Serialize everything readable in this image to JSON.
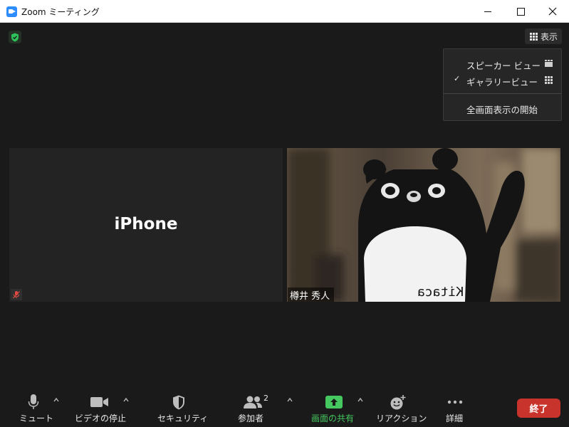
{
  "window": {
    "title": "Zoom ミーティング"
  },
  "top_bar": {
    "view_button_label": "表示"
  },
  "view_menu": {
    "speaker_view": "スピーカー ビュー",
    "gallery_view": "ギャラリービュー",
    "gallery_checked": true,
    "fullscreen": "全画面表示の開始"
  },
  "participants": [
    {
      "name": "iPhone",
      "audio_muted": true,
      "video_on": false
    },
    {
      "name": "樽井 秀人",
      "video_on": true
    }
  ],
  "toolbar": {
    "mute": "ミュート",
    "stop_video": "ビデオの停止",
    "security": "セキュリティ",
    "participants": "参加者",
    "participants_count": "2",
    "share_screen": "画面の共有",
    "reactions": "リアクション",
    "more": "詳細",
    "end": "終了"
  },
  "colors": {
    "background": "#1a1a1a",
    "share_green": "#44c85f",
    "end_red": "#c8342c",
    "shield_green": "#2ec25b",
    "app_blue": "#2d8cff"
  }
}
